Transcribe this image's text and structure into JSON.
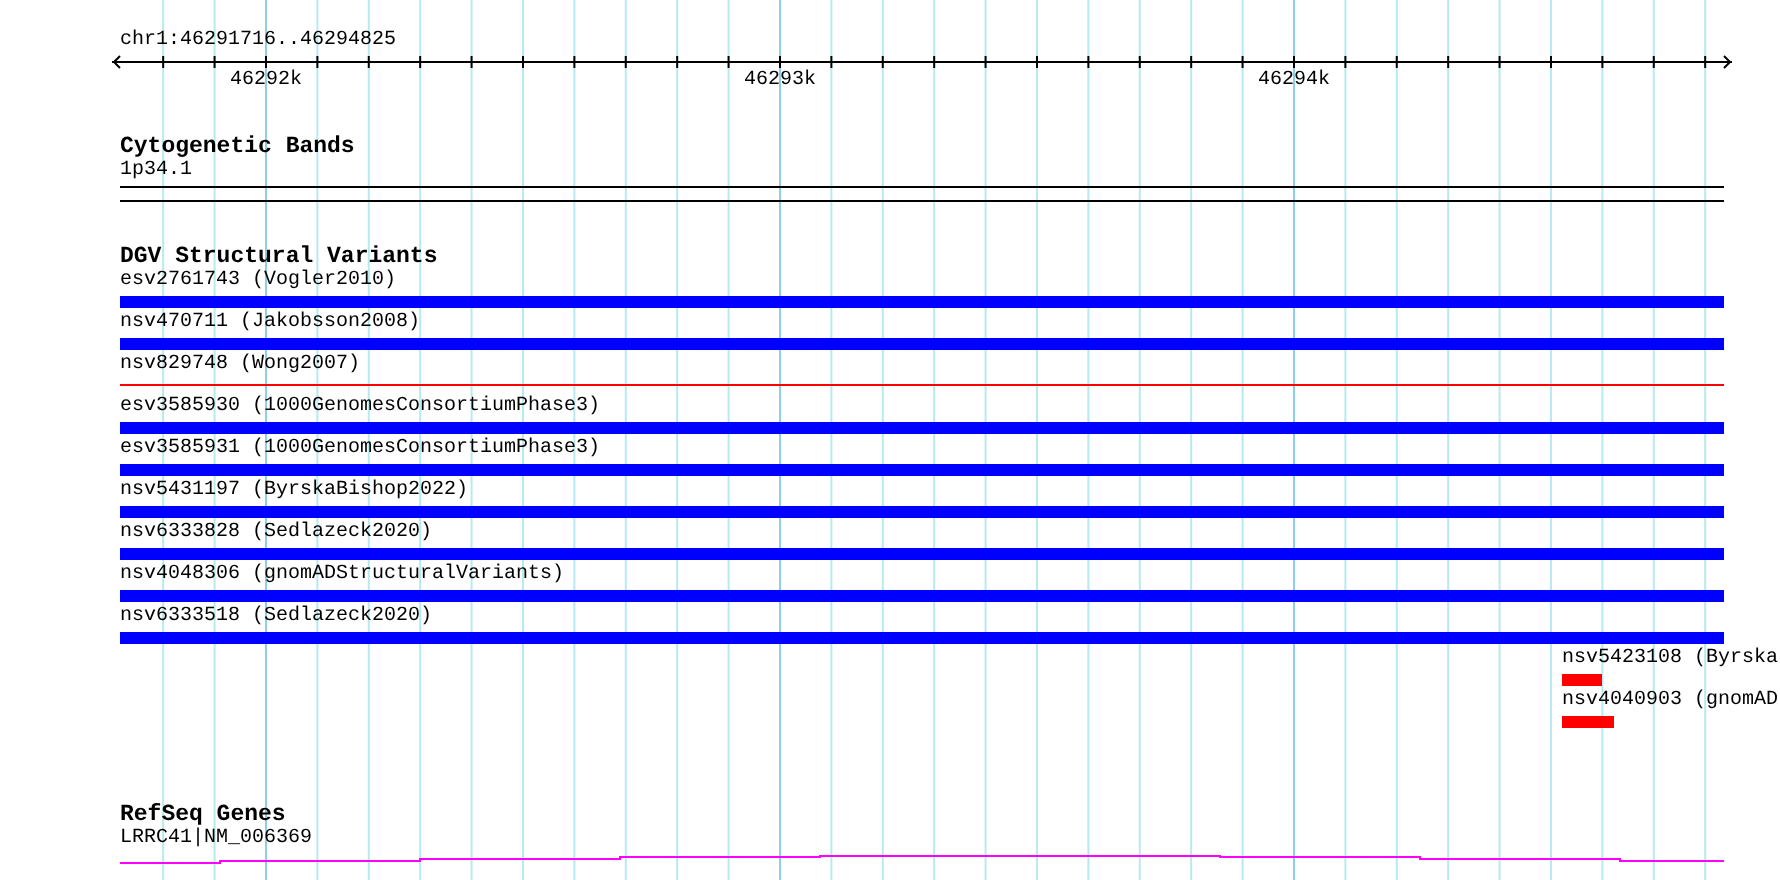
{
  "location": "chr1:46291716..46294825",
  "ruler": {
    "labels": [
      "46292k",
      "46293k",
      "46294k"
    ]
  },
  "tracks": [
    {
      "kind": "cytoband",
      "title": "Cytogenetic Bands",
      "features": [
        {
          "label": "1p34.1"
        }
      ]
    },
    {
      "kind": "variants",
      "title": "DGV Structural Variants",
      "features": [
        {
          "label": "esv2761743 (Vogler2010)",
          "kind": "span",
          "color": "#0000ff"
        },
        {
          "label": "nsv470711 (Jakobsson2008)",
          "kind": "span",
          "color": "#0000ff"
        },
        {
          "label": "nsv829748 (Wong2007)",
          "kind": "line",
          "color": "#ff0000"
        },
        {
          "label": "esv3585930 (1000GenomesConsortiumPhase3)",
          "kind": "span",
          "color": "#0000ff"
        },
        {
          "label": "esv3585931 (1000GenomesConsortiumPhase3)",
          "kind": "span",
          "color": "#0000ff"
        },
        {
          "label": "nsv5431197 (ByrskaBishop2022)",
          "kind": "span",
          "color": "#0000ff"
        },
        {
          "label": "nsv6333828 (Sedlazeck2020)",
          "kind": "span",
          "color": "#0000ff"
        },
        {
          "label": "nsv4048306 (gnomADStructuralVariants)",
          "kind": "span",
          "color": "#0000ff"
        },
        {
          "label": "nsv6333518 (Sedlazeck2020)",
          "kind": "span",
          "color": "#0000ff"
        },
        {
          "label": "nsv5423108 (Byrska",
          "kind": "short",
          "color": "#ff0000"
        },
        {
          "label": "nsv4040903 (gnomAD",
          "kind": "short",
          "color": "#ff0000"
        }
      ]
    },
    {
      "kind": "gene",
      "title": "RefSeq Genes",
      "features": [
        {
          "label": "LRRC41|NM_006369"
        }
      ]
    }
  ]
}
